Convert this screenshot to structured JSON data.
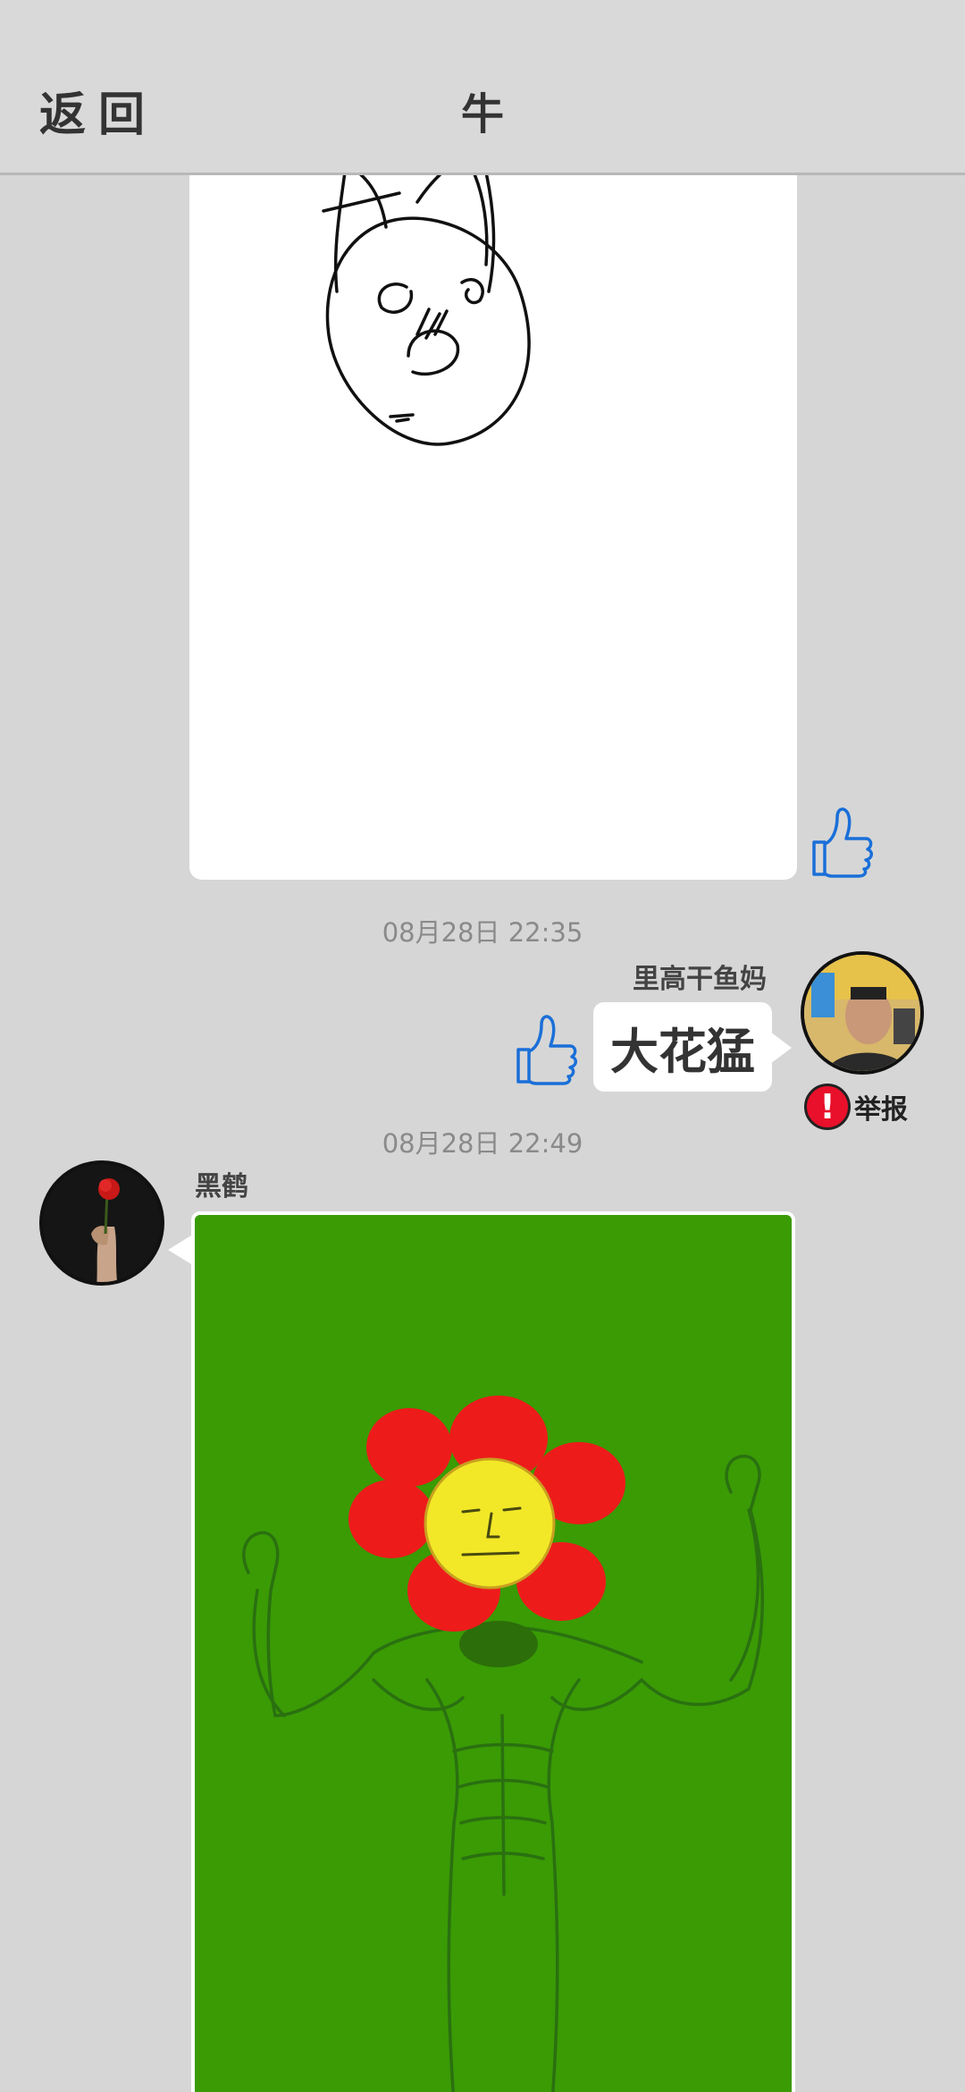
{
  "header": {
    "back_label": "返回",
    "title": "牛"
  },
  "messages": [
    {
      "type": "drawing",
      "side": "left",
      "image": "sketch-rabbit-face"
    },
    {
      "timestamp": "08月28日  22:35",
      "sender": "里高干鱼妈",
      "side": "right",
      "text": "大花猛",
      "report_label": "举报"
    },
    {
      "timestamp": "08月28日  22:49",
      "sender": "黑鹤",
      "side": "left",
      "type": "drawing",
      "image": "flower-head-muscle-man"
    }
  ],
  "icons": {
    "like": "thumbs-up-icon",
    "report": "exclamation-icon"
  },
  "colors": {
    "background": "#d6d6d6",
    "like_blue": "#1a6fd8",
    "report_red": "#e8102a",
    "drawing_green": "#3a9b05"
  }
}
